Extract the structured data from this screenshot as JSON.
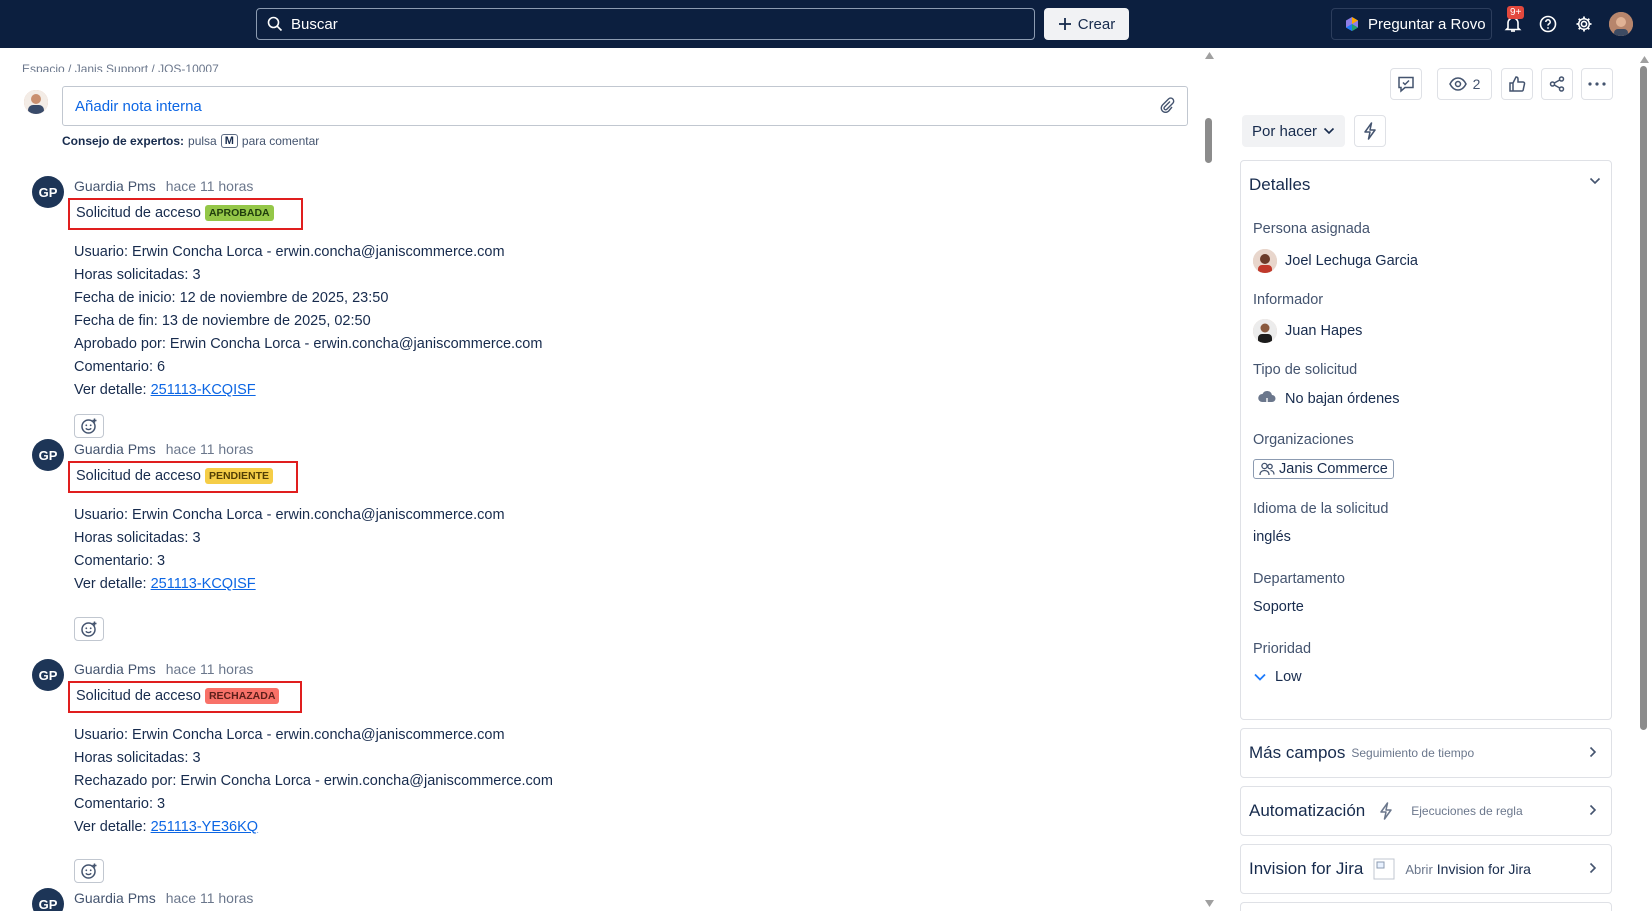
{
  "topbar": {
    "search_placeholder": "Buscar",
    "create_label": "Crear",
    "rovo_label": "Preguntar a Rovo",
    "notifications_badge": "9+"
  },
  "breadcrumb": "Espacio  /  Janis Support  /  JOS-10007",
  "note": {
    "placeholder": "Añadir nota interna",
    "tip_bold": "Consejo de expertos:",
    "tip_pre": "pulsa",
    "tip_key": "M",
    "tip_post": "para comentar"
  },
  "comments": [
    {
      "initials": "GP",
      "author": "Guardia Pms",
      "time": "hace 11 horas",
      "title": "Solicitud de acceso",
      "status": "APROBADA",
      "status_color": "#94c748",
      "lines": [
        "Usuario: Erwin Concha Lorca - erwin.concha@janiscommerce.com",
        "Horas solicitadas: 3",
        "Fecha de inicio: 12 de noviembre de 2025, 23:50",
        "Fecha de fin: 13 de noviembre de 2025, 02:50",
        "Aprobado por: Erwin Concha Lorca - erwin.concha@janiscommerce.com",
        "Comentario: 6"
      ],
      "detail_label": "Ver detalle:",
      "detail_link": "251113-KCQISF"
    },
    {
      "initials": "GP",
      "author": "Guardia Pms",
      "time": "hace 11 horas",
      "title": "Solicitud de acceso",
      "status": "PENDIENTE",
      "status_color": "#f5cd47",
      "lines": [
        "Usuario: Erwin Concha Lorca - erwin.concha@janiscommerce.com",
        "Horas solicitadas: 3",
        "Comentario: 3"
      ],
      "detail_label": "Ver detalle:",
      "detail_link": "251113-KCQISF"
    },
    {
      "initials": "GP",
      "author": "Guardia Pms",
      "time": "hace 11 horas",
      "title": "Solicitud de acceso",
      "status": "RECHAZADA",
      "status_color": "#f87168",
      "lines": [
        "Usuario: Erwin Concha Lorca - erwin.concha@janiscommerce.com",
        "Horas solicitadas: 3",
        "Rechazado por: Erwin Concha Lorca - erwin.concha@janiscommerce.com",
        "Comentario: 3"
      ],
      "detail_label": "Ver detalle:",
      "detail_link": "251113-YE36KQ"
    },
    {
      "initials": "GP",
      "author": "Guardia Pms",
      "time": "hace 11 horas"
    }
  ],
  "right_panel": {
    "watchers_count": "2",
    "status_label": "Por hacer",
    "details_title": "Detalles",
    "fields": {
      "assignee_label": "Persona asignada",
      "assignee": "Joel Lechuga Garcia",
      "reporter_label": "Informador",
      "reporter": "Juan Hapes",
      "request_type_label": "Tipo de solicitud",
      "request_type": "No bajan órdenes",
      "orgs_label": "Organizaciones",
      "org": "Janis Commerce",
      "language_label": "Idioma de la solicitud",
      "language": "inglés",
      "department_label": "Departamento",
      "department": "Soporte",
      "priority_label": "Prioridad",
      "priority": "Low"
    },
    "more_fields": {
      "title": "Más campos",
      "sub": "Seguimiento de tiempo"
    },
    "automation": {
      "title": "Automatización",
      "sub": "Ejecuciones de regla"
    },
    "invision": {
      "title": "Invision for Jira",
      "sub_pre": "Abrir",
      "sub_bold": "Invision for Jira"
    }
  }
}
